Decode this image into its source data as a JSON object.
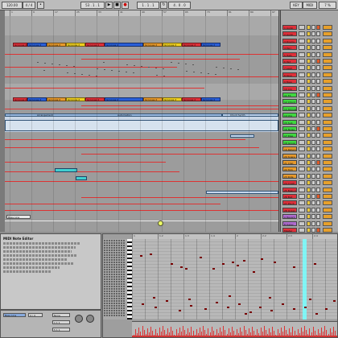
{
  "transport": {
    "tempo": "120.00",
    "signature": "4 / 4",
    "position": "53 . 1 . 1",
    "loop_start": "1 . 1 . 1",
    "loop_length": "4 . 0 . 0",
    "key_label": "KEY",
    "midi_label": "MIDI",
    "cpu": "7 %"
  },
  "arrangement": {
    "ruler_marks": [
      "1",
      "9",
      "17",
      "25",
      "33",
      "41",
      "49",
      "57",
      "65",
      "73",
      "81",
      "89",
      "97"
    ],
    "top_clips": [
      {
        "label": "Grooves 2",
        "color": "#e0303a"
      },
      {
        "label": "Grooves 2",
        "color": "#2a5fd8"
      },
      {
        "label": "Grooves 2",
        "color": "#e89a2c"
      },
      {
        "label": "Grooves 2",
        "color": "#f0d020"
      },
      {
        "label": "Grooves 2",
        "color": "#e0303a"
      },
      {
        "label": "Grooves 2",
        "color": "#2a5fd8"
      },
      {
        "label": "Grooves 2",
        "color": "#e89a2c"
      },
      {
        "label": "Grooves 2",
        "color": "#f0d020"
      },
      {
        "label": "Grooves 2",
        "color": "#e0303a"
      },
      {
        "label": "Grooves 2",
        "color": "#2a5fd8"
      }
    ],
    "mid_labels": [
      "Arrangement",
      "Automation",
      "Chord Synth"
    ],
    "bottom_label": "Bass Line"
  },
  "tracks": [
    {
      "name": "1 Audio",
      "color": "#e0303a"
    },
    {
      "name": "2 Audio",
      "color": "#e0303a"
    },
    {
      "name": "3 Drums",
      "color": "#e0303a"
    },
    {
      "name": "4 Perc",
      "color": "#e0303a"
    },
    {
      "name": "5 Hats",
      "color": "#e0303a"
    },
    {
      "name": "6 Pad",
      "color": "#e0303a"
    },
    {
      "name": "7 Lead",
      "color": "#e0303a"
    },
    {
      "name": "8 Keys",
      "color": "#e0303a"
    },
    {
      "name": "9 Bass",
      "color": "#e0303a"
    },
    {
      "name": "10 Arp",
      "color": "#e0303a"
    },
    {
      "name": "11 FX",
      "color": "#40d840"
    },
    {
      "name": "12 Chord",
      "color": "#40d840"
    },
    {
      "name": "13 Strings",
      "color": "#40d840"
    },
    {
      "name": "14 Vox",
      "color": "#40d840"
    },
    {
      "name": "15 Sub",
      "color": "#40d840"
    },
    {
      "name": "16 Noise",
      "color": "#40d840"
    },
    {
      "name": "17 Rise",
      "color": "#40d840"
    },
    {
      "name": "18 Group",
      "color": "#40d840"
    },
    {
      "name": "19 Return",
      "color": "#e89a2c"
    },
    {
      "name": "20 Snare",
      "color": "#e89a2c"
    },
    {
      "name": "21 Clap",
      "color": "#e89a2c"
    },
    {
      "name": "22 Tom",
      "color": "#e89a2c"
    },
    {
      "name": "23 Ride",
      "color": "#e89a2c"
    },
    {
      "name": "24 Crash",
      "color": "#e0303a"
    },
    {
      "name": "25 Bass 2",
      "color": "#e0303a"
    },
    {
      "name": "26 Bell",
      "color": "#e0303a"
    },
    {
      "name": "27 Pluck",
      "color": "#e0303a"
    },
    {
      "name": "28 Organ",
      "color": "#e0303a"
    },
    {
      "name": "A Reverb",
      "color": "#b06cd0"
    },
    {
      "name": "B Delay",
      "color": "#b06cd0"
    },
    {
      "name": "Master",
      "color": "#e0303a"
    }
  ],
  "info_view": {
    "title": "MIDI Note Editor"
  },
  "clip_view": {
    "clip_name": "Bass Line",
    "signature": "4 / 4",
    "groove": "None",
    "start": "1 1 1",
    "end": "5 1 1"
  },
  "piano_roll": {
    "ruler_marks": [
      "1",
      "1.2",
      "1.3",
      "1.4",
      "2",
      "2.2",
      "2.3",
      "2.4"
    ]
  }
}
